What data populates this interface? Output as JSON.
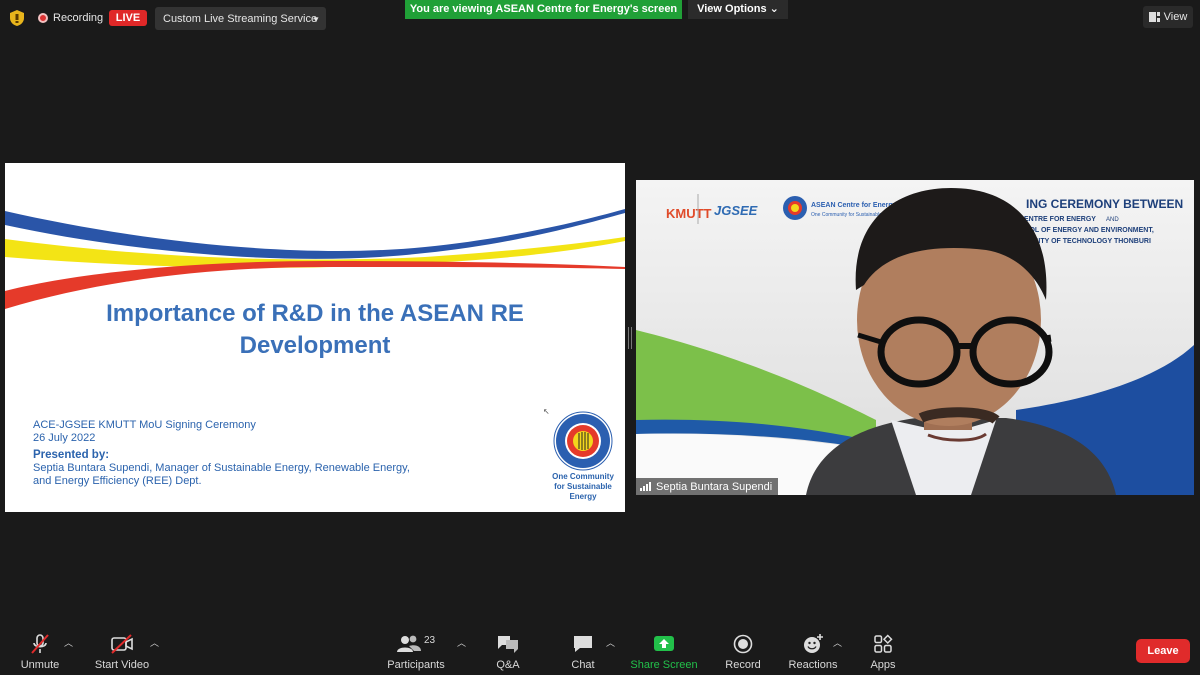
{
  "topbar": {
    "recording_label": "Recording",
    "live_label": "LIVE",
    "stream_label": "Custom Live Streaming Service",
    "viewing_banner": "You are viewing ASEAN Centre for Energy's screen",
    "view_options_label": "View Options",
    "view_label": "View"
  },
  "slide": {
    "title_line1": "Importance of R&D in the ASEAN RE",
    "title_line2": "Development",
    "event": "ACE-JGSEE KMUTT MoU Signing Ceremony",
    "date": "26 July 2022",
    "presented_by": "Presented by:",
    "presenter_line1": "Septia Buntara Supendi, Manager of Sustainable Energy, Renewable Energy,",
    "presenter_line2": "and Energy Efficiency (REE) Dept.",
    "logo_ring_text": "ASEAN CENTRE FOR ENERGY",
    "logo_center": "ACE",
    "logo_tagline_1": "One Community",
    "logo_tagline_2": "for Sustainable",
    "logo_tagline_3": "Energy"
  },
  "video": {
    "participant_name": "Septia Buntara Supendi",
    "banner_kmutt": "KMUTT",
    "banner_jgsee": "JGSEE",
    "banner_ace_1": "ASEAN Centre for Energy",
    "banner_ace_2": "One Community for Sustainable Energy",
    "banner_title": "ING CEREMONY BETWEEN",
    "banner_line1": "ENTRE FOR ENERGY",
    "banner_line1_and": "AND",
    "banner_line2": "OOL OF ENERGY AND ENVIRONMENT,",
    "banner_line3": "ERSITY OF TECHNOLOGY THONBURI"
  },
  "toolbar": {
    "unmute": "Unmute",
    "start_video": "Start Video",
    "participants": "Participants",
    "participant_count": "23",
    "qa": "Q&A",
    "chat": "Chat",
    "share_screen": "Share Screen",
    "record": "Record",
    "reactions": "Reactions",
    "apps": "Apps",
    "leave": "Leave"
  },
  "colors": {
    "accent_green": "#20a037",
    "leave_red": "#e02b2b",
    "slide_blue": "#3a70b8"
  }
}
